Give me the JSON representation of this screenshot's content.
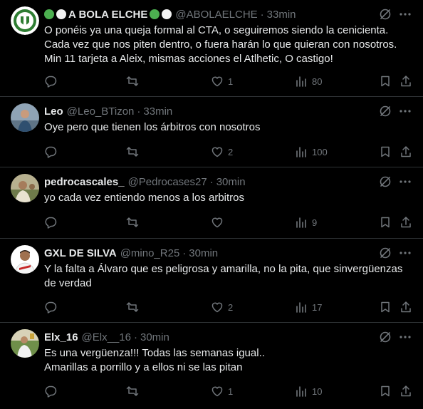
{
  "colors": {
    "background": "#000000",
    "text": "#e7e9ea",
    "muted": "#71767b",
    "divider": "#2f3336",
    "green_dot": "#4caf50",
    "white_dot": "#f2f2f2"
  },
  "tweets": [
    {
      "name": "A BOLA ELCHE",
      "handle": "@ABOLAELCHE",
      "time": "33min",
      "text": "O ponéis ya una queja formal al CTA, o seguiremos siendo la cenicienta.\nCada vez que nos piten dentro, o fuera harán lo que quieran con nosotros.\nMin 11 tarjeta a Aleix, mismas acciones el Atlhetic, O castigo!",
      "replies": "",
      "reposts": "",
      "likes": "1",
      "views": "80",
      "avatar_icon": "club-crest-icon"
    },
    {
      "name": "Leo",
      "handle": "@Leo_BTizon",
      "time": "33min",
      "text": "Oye pero que tienen los árbitros con nosotros",
      "replies": "",
      "reposts": "",
      "likes": "2",
      "views": "100",
      "avatar_icon": "person-photo-icon"
    },
    {
      "name": "pedrocascales_",
      "handle": "@Pedrocases27",
      "time": "30min",
      "text": "yo cada vez entiendo menos a los arbitros",
      "replies": "",
      "reposts": "",
      "likes": "",
      "views": "9",
      "avatar_icon": "person-photo-icon"
    },
    {
      "name": "GXL DE SILVA",
      "handle": "@mino_R25",
      "time": "30min",
      "text": "Y la falta a Álvaro que es peligrosa y amarilla, no la pita, que sinvergüenzas\nde verdad",
      "replies": "",
      "reposts": "",
      "likes": "2",
      "views": "17",
      "avatar_icon": "player-photo-icon"
    },
    {
      "name": "Elx_16",
      "handle": "@Elx__16",
      "time": "30min",
      "text": "Es una vergüenza!!! Todas las semanas igual..\nAmarillas a porrillo y a ellos ni se las pitan",
      "replies": "",
      "reposts": "",
      "likes": "1",
      "views": "10",
      "avatar_icon": "person-photo-icon"
    }
  ]
}
